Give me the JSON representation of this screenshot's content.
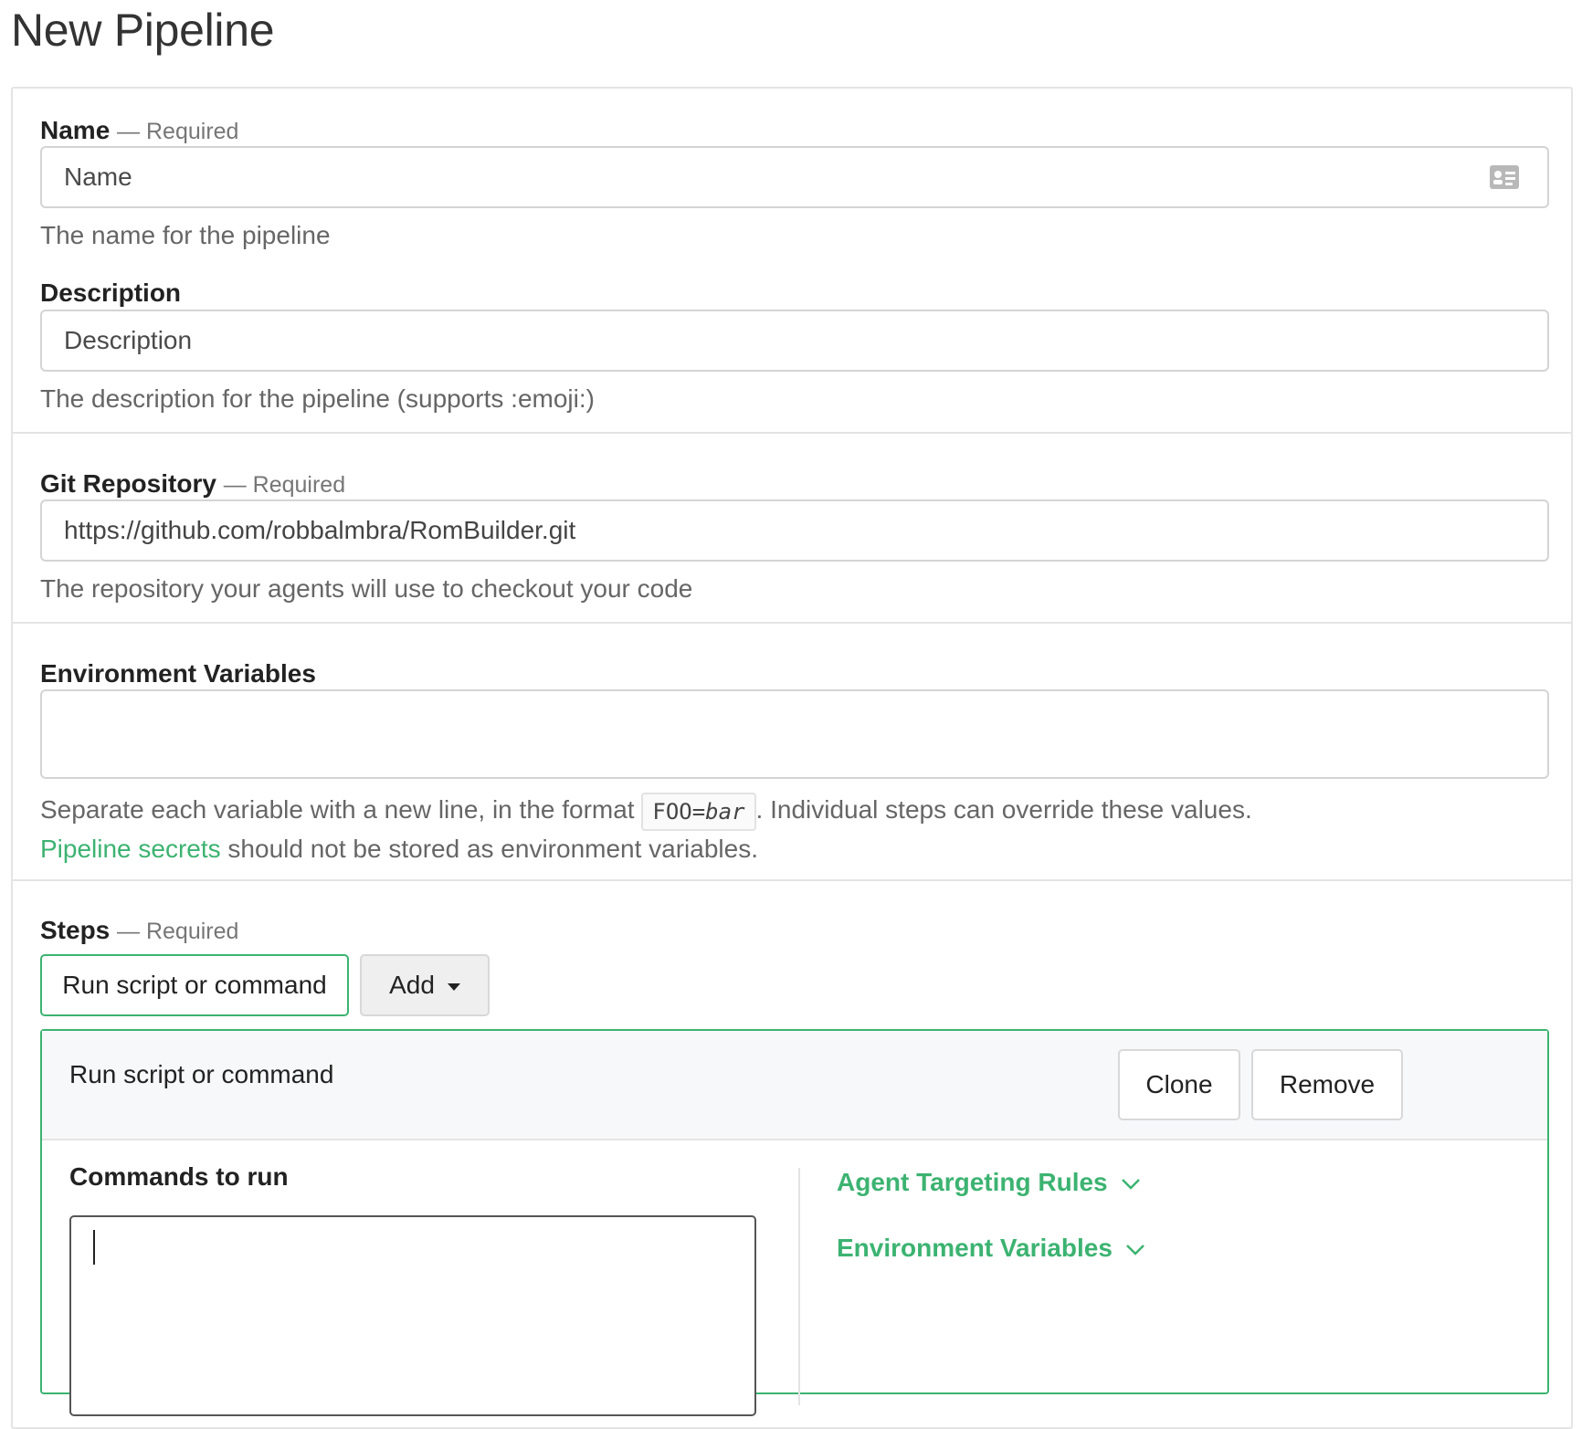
{
  "page": {
    "title": "New Pipeline"
  },
  "form": {
    "name": {
      "label": "Name",
      "required": "— Required",
      "placeholder": "Name",
      "help": "The name for the pipeline"
    },
    "description": {
      "label": "Description",
      "placeholder": "Description",
      "help": "The description for the pipeline (supports :emoji:)"
    },
    "repository": {
      "label": "Git Repository",
      "required": "— Required",
      "value": "https://github.com/robbalmbra/RomBuilder.git",
      "help": "The repository your agents will use to checkout your code"
    },
    "env": {
      "label": "Environment Variables",
      "value": "",
      "help_before": "Separate each variable with a new line, in the format ",
      "code_key": "FOO=",
      "code_val": "bar",
      "help_after": ". Individual steps can override these values.",
      "secrets_link": "Pipeline secrets",
      "secrets_text": " should not be stored as environment variables."
    },
    "steps": {
      "label": "Steps",
      "required": "— Required",
      "step_button": "Run script or command",
      "add_button": "Add",
      "step": {
        "title": "Run script or command",
        "clone_button": "Clone",
        "remove_button": "Remove",
        "commands_label": "Commands to run",
        "commands_value": "",
        "agent_rules": "Agent Targeting Rules",
        "env_toggle": "Environment Variables"
      }
    }
  },
  "colors": {
    "accent": "#3cb371",
    "border": "#e4e4e4",
    "help_text": "#666666"
  },
  "icons": {
    "name_field": "id-card-icon",
    "add_caret": "caret-down-icon",
    "toggle": "chevron-down-icon"
  }
}
